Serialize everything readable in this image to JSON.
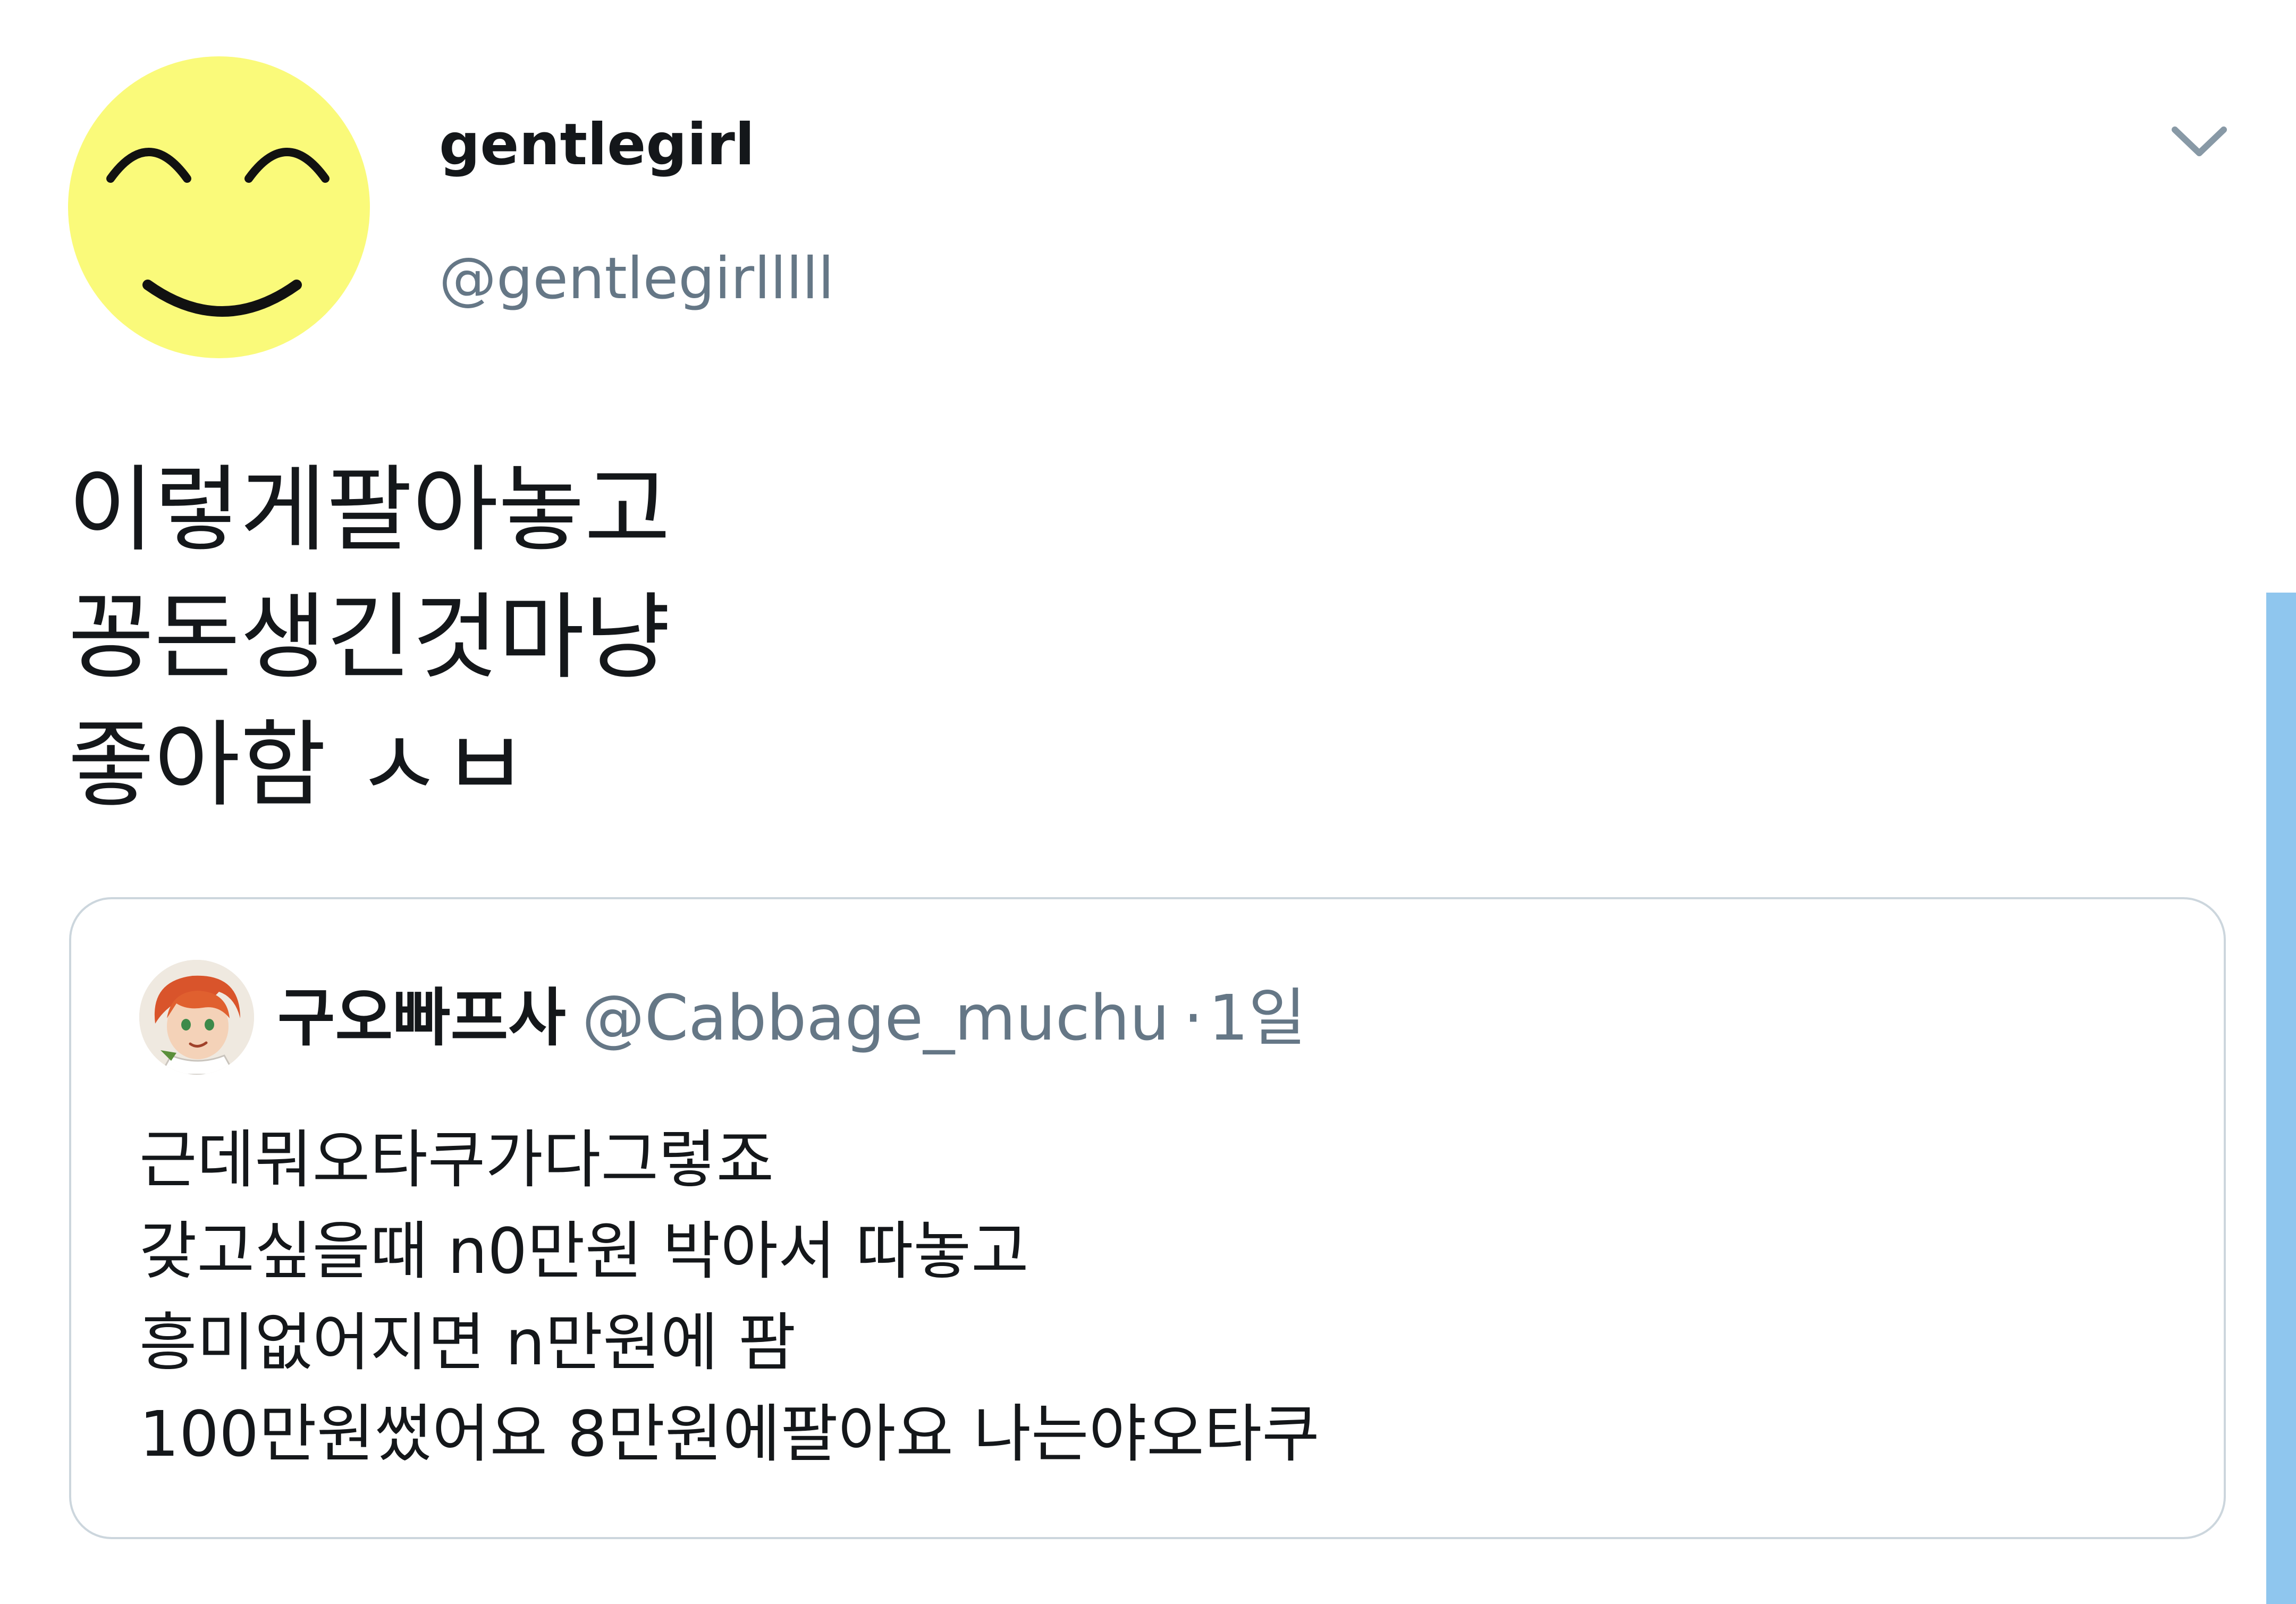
{
  "tweet": {
    "display_name": "gentlegirl",
    "handle": "@gentlegirlllll",
    "avatar_icon": "smiley-face-icon",
    "menu_icon": "chevron-down-icon",
    "text_lines": [
      "이렇게팔아놓고",
      "꽁돈생긴것마냥",
      "좋아함 ㅅㅂ"
    ]
  },
  "quoted_tweet": {
    "display_name": "구오빠프사",
    "handle": "@Cabbage_muchu",
    "separator": "·",
    "time": "1일",
    "avatar_icon": "anime-character-avatar",
    "text_lines": [
      "근데뭐오타쿠가다그렇죠",
      "갖고싶을때 n0만원 박아서 따놓고",
      "흥미없어지면 n만원에 팜",
      "100만원썼어요 8만원에팔아요 나는야오타쿠"
    ]
  },
  "colors": {
    "avatar_yellow": "#fafa7a",
    "text_primary": "#14171a",
    "text_secondary": "#657786",
    "card_border": "#ccd6dd",
    "scrollbar": "#8fc6ee"
  }
}
